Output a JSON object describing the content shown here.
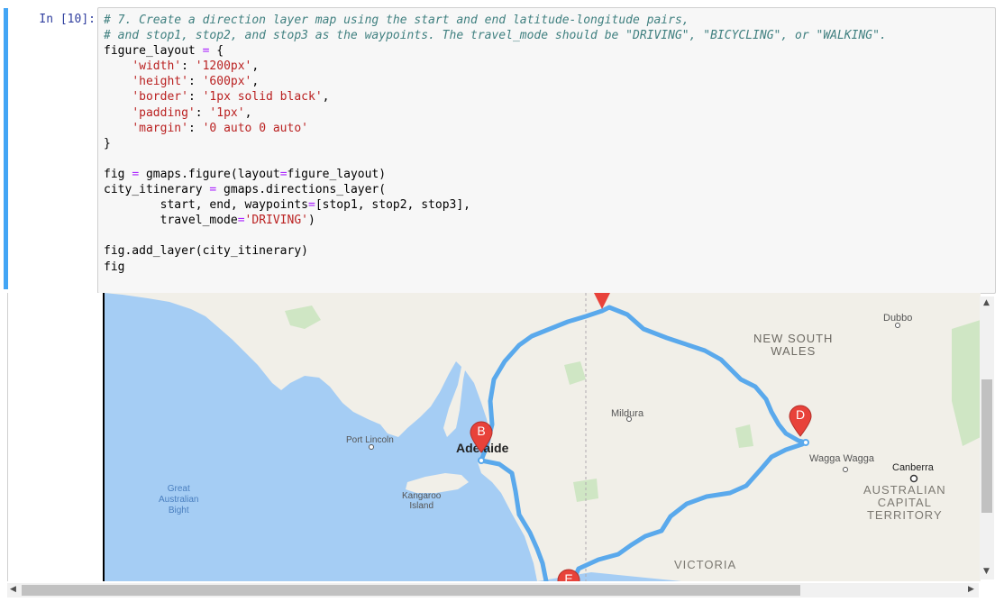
{
  "cell": {
    "prompt": "In [10]:",
    "comment1": "# 7. Create a direction layer map using the start and end latitude-longitude pairs,",
    "comment2": "# and stop1, stop2, and stop3 as the waypoints. The travel_mode should be \"DRIVING\", \"BICYCLING\", or \"WALKING\".",
    "figure_layout_var": "figure_layout",
    "width_key": "'width'",
    "width_val": "'1200px'",
    "height_key": "'height'",
    "height_val": "'600px'",
    "border_key": "'border'",
    "border_val": "'1px solid black'",
    "padding_key": "'padding'",
    "padding_val": "'1px'",
    "margin_key": "'margin'",
    "margin_val": "'0 auto 0 auto'",
    "fig_line_a": "fig ",
    "fig_line_b": " gmaps.figure(layout",
    "fig_line_c": "figure_layout)",
    "itin_line_a": "city_itinerary ",
    "itin_line_b": " gmaps.directions_layer(",
    "start_line_a": "        start, end, waypoints",
    "start_line_b": "[stop1, stop2, stop3],",
    "travel_a": "        travel_mode",
    "travel_val": "'DRIVING'",
    "add_layer": "fig.add_layer(city_itinerary)",
    "fig_last": "fig"
  },
  "map": {
    "labels": {
      "nsw1": "NEW SOUTH",
      "nsw2": "WALES",
      "dubbo": "Dubbo",
      "mildura": "Mildura",
      "adelaide": "Adelaide",
      "port_lincoln": "Port Lincoln",
      "wagga": "Wagga Wagga",
      "canberra": "Canberra",
      "act1": "AUSTRALIAN",
      "act2": "CAPITAL",
      "act3": "TERRITORY",
      "great1": "Great",
      "great2": "Australian",
      "great3": "Bight",
      "kangaroo1": "Kangaroo",
      "kangaroo2": "Island",
      "victoria": "VICTORIA"
    },
    "markers": {
      "b": "B",
      "d": "D",
      "e": "E"
    },
    "colors": {
      "route": "#5aa9ec",
      "marker": "#e8423a",
      "water": "#a5cdf4",
      "land": "#f1efe8"
    }
  },
  "icons": {
    "scroll_up": "triangle-up",
    "scroll_down": "triangle-down",
    "scroll_left": "triangle-left",
    "scroll_right": "triangle-right"
  }
}
